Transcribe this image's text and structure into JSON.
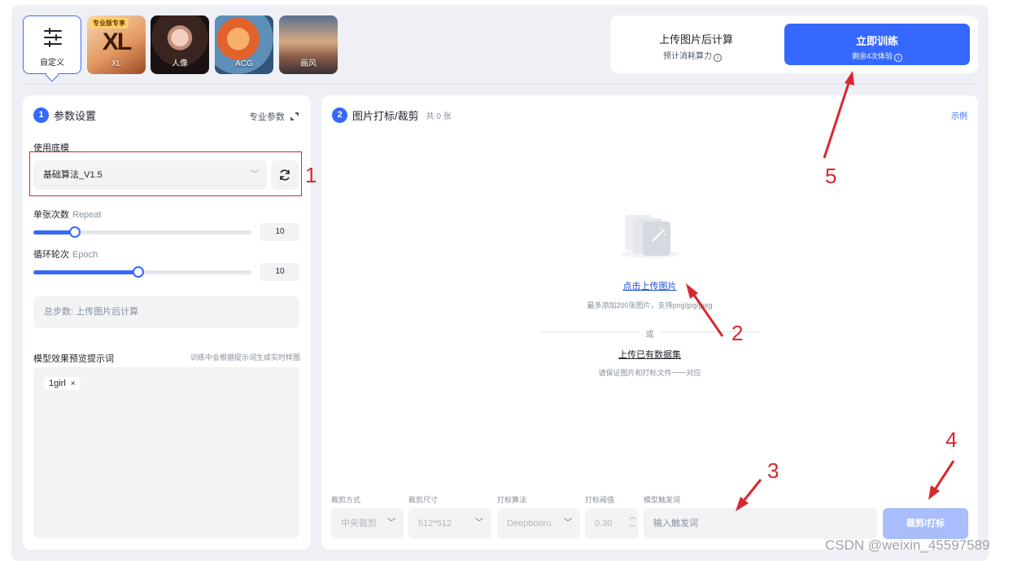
{
  "model_tiles": [
    {
      "label": "自定义",
      "selected": true
    },
    {
      "label": "XL",
      "tag": "专业版专享",
      "big_text": "XL"
    },
    {
      "label": "人像"
    },
    {
      "label": "ACG"
    },
    {
      "label": "画风"
    }
  ],
  "cost": {
    "title": "上传图片后计算",
    "subtitle": "预计消耗算力"
  },
  "train_button": {
    "label": "立即训练",
    "sub": "剩余4次体验"
  },
  "params": {
    "step": "1",
    "title": "参数设置",
    "pro_label": "专业参数",
    "base_model_label": "使用底模",
    "base_model_value": "基础算法_V1.5",
    "repeat_label": "单张次数",
    "repeat_en": "Repeat",
    "repeat_value": "10",
    "repeat_fraction": 0.19,
    "epoch_label": "循环轮次",
    "epoch_en": "Epoch",
    "epoch_value": "10",
    "epoch_fraction": 0.48,
    "total_steps": "总步数: 上传图片后计算",
    "prompt_label": "模型效果预览提示词",
    "prompt_hint": "训练中会根据提示词生成实时样图",
    "prompt_tag": "1girl"
  },
  "images": {
    "step": "2",
    "title": "图片打标/裁剪",
    "count": "共 0 张",
    "example": "示例",
    "upload_link": "点击上传图片",
    "upload_note": "最多添加200张图片，支持png/jpg/jpeg",
    "or": "或",
    "dataset_link": "上传已有数据集",
    "dataset_note": "请保证图片和打标文件一一对应"
  },
  "controls": {
    "crop_mode_label": "裁剪方式",
    "crop_mode_value": "中央裁剪",
    "crop_size_label": "裁剪尺寸",
    "crop_size_value": "512*512",
    "tag_algo_label": "打标算法",
    "tag_algo_value": "Deepbooru",
    "threshold_label": "打标阈值",
    "threshold_value": "0.30",
    "trigger_label": "模型触发词",
    "trigger_placeholder": "输入触发词",
    "crop_button": "裁剪/打标"
  },
  "annotations": [
    "1",
    "2",
    "3",
    "4",
    "5"
  ],
  "watermark": "CSDN @weixin_45597589",
  "colors": {
    "accent": "#3468ff",
    "annotation_red": "#d9272f",
    "disabled_button": "#a9bdfc"
  }
}
